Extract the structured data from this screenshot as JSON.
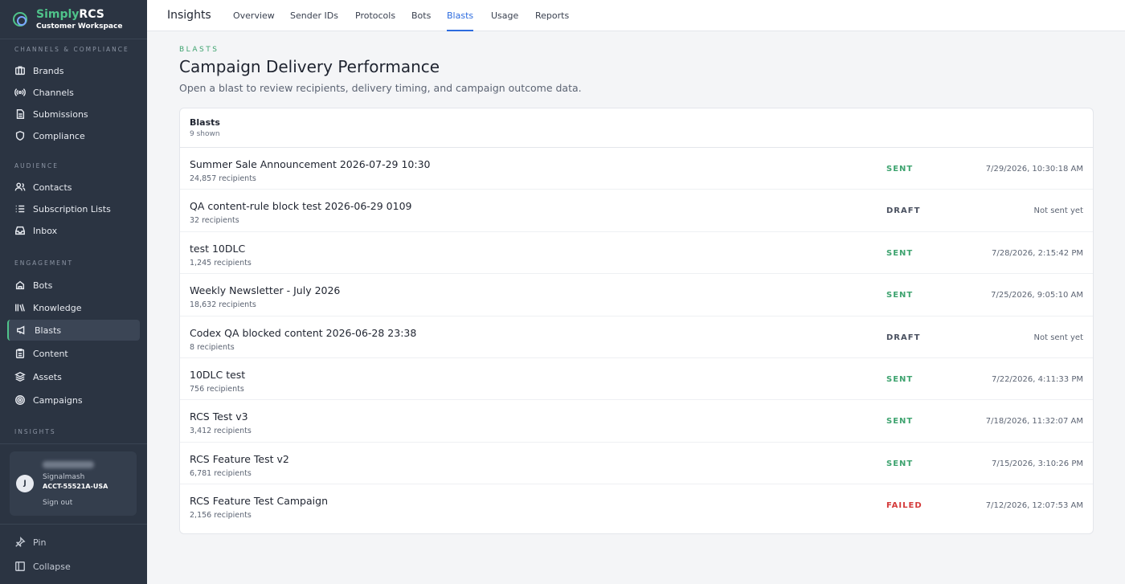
{
  "brand": {
    "name_a": "Simply",
    "name_b": "RCS",
    "subtitle": "Customer Workspace"
  },
  "sidebar": {
    "sections": [
      {
        "label": "Channels & Compliance"
      },
      {
        "label": "Audience"
      },
      {
        "label": "Engagement"
      },
      {
        "label": "Insights"
      }
    ],
    "items": [
      {
        "label": "Brands",
        "icon": "briefcase-icon"
      },
      {
        "label": "Channels",
        "icon": "signal-icon"
      },
      {
        "label": "Submissions",
        "icon": "document-icon"
      },
      {
        "label": "Compliance",
        "icon": "shield-icon"
      },
      {
        "label": "Contacts",
        "icon": "users-icon"
      },
      {
        "label": "Subscription Lists",
        "icon": "list-icon"
      },
      {
        "label": "Inbox",
        "icon": "inbox-icon"
      },
      {
        "label": "Bots",
        "icon": "bot-icon"
      },
      {
        "label": "Knowledge",
        "icon": "books-icon"
      },
      {
        "label": "Blasts",
        "icon": "megaphone-icon",
        "active": true
      },
      {
        "label": "Content",
        "icon": "clipboard-icon"
      },
      {
        "label": "Assets",
        "icon": "layers-icon"
      },
      {
        "label": "Campaigns",
        "icon": "target-icon"
      }
    ],
    "user": {
      "avatar": "J",
      "org": "Signalmash",
      "account": "ACCT-55521A-USA",
      "signout": "Sign out"
    },
    "footer": {
      "pin": "Pin",
      "collapse": "Collapse"
    }
  },
  "topbar": {
    "title": "Insights",
    "tabs": [
      "Overview",
      "Sender IDs",
      "Protocols",
      "Bots",
      "Blasts",
      "Usage",
      "Reports"
    ],
    "active_tab": "Blasts"
  },
  "page": {
    "eyebrow": "Blasts",
    "title": "Campaign Delivery Performance",
    "subtitle": "Open a blast to review recipients, delivery timing, and campaign outcome data."
  },
  "blasts": {
    "header": "Blasts",
    "count": "9 shown",
    "rows": [
      {
        "name": "Summer Sale Announcement 2026-07-29 10:30",
        "recipients": "24,857 recipients",
        "status": "SENT",
        "time": "7/29/2026, 10:30:18 AM"
      },
      {
        "name": "QA content-rule block test 2026-06-29 0109",
        "recipients": "32 recipients",
        "status": "DRAFT",
        "time": "Not sent yet"
      },
      {
        "name": "test 10DLC",
        "recipients": "1,245 recipients",
        "status": "SENT",
        "time": "7/28/2026, 2:15:42 PM"
      },
      {
        "name": "Weekly Newsletter - July 2026",
        "recipients": "18,632 recipients",
        "status": "SENT",
        "time": "7/25/2026, 9:05:10 AM"
      },
      {
        "name": "Codex QA blocked content 2026-06-28 23:38",
        "recipients": "8 recipients",
        "status": "DRAFT",
        "time": "Not sent yet"
      },
      {
        "name": "10DLC test",
        "recipients": "756 recipients",
        "status": "SENT",
        "time": "7/22/2026, 4:11:33 PM"
      },
      {
        "name": "RCS Test v3",
        "recipients": "3,412 recipients",
        "status": "SENT",
        "time": "7/18/2026, 11:32:07 AM"
      },
      {
        "name": "RCS Feature Test v2",
        "recipients": "6,781 recipients",
        "status": "SENT",
        "time": "7/15/2026, 3:10:26 PM"
      },
      {
        "name": "RCS Feature Test Campaign",
        "recipients": "2,156 recipients",
        "status": "FAILED",
        "time": "7/12/2026, 12:07:53 AM"
      }
    ]
  },
  "colors": {
    "accent": "#2d6cdf",
    "brand_green": "#4fc38a",
    "sent": "#3ea36f",
    "failed": "#d43a3a",
    "sidebar_bg": "#2b3442"
  }
}
